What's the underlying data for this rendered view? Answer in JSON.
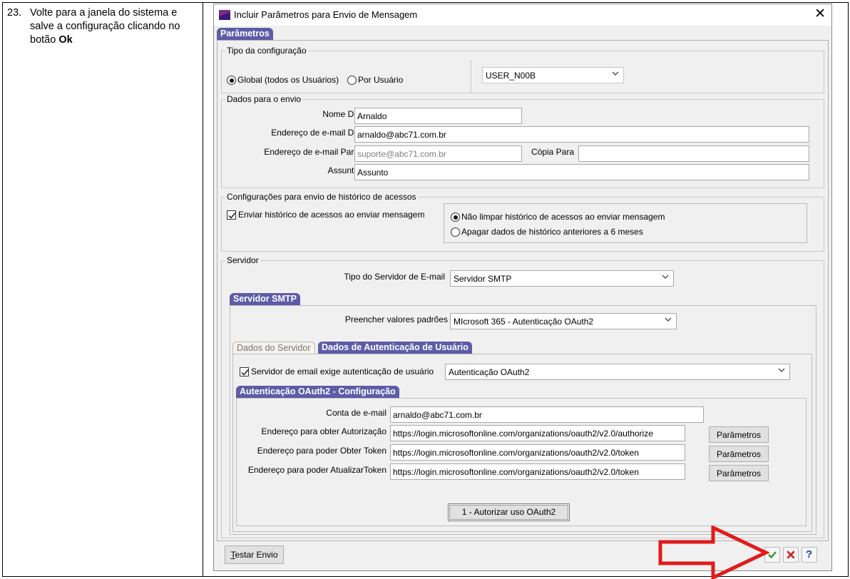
{
  "instruction": {
    "number": "23.",
    "text_before": "Volte para a janela do sistema e salve a configuração clicando no botão ",
    "text_bold": "Ok"
  },
  "dialog": {
    "title": "Incluir Parâmetros para Envio de Mensagem",
    "main_tab": "Parâmetros",
    "tipo_config": {
      "legend": "Tipo da configuração",
      "radio_global": "Global (todos os Usuários)",
      "radio_por_usuario": "Por Usuário",
      "selected": "global",
      "user_combo": "USER_N00B"
    },
    "dados_envio": {
      "legend": "Dados para o envio",
      "nome_de_label": "Nome De",
      "nome_de_value": "Arnaldo",
      "email_de_label": "Endereço de e-mail De",
      "email_de_value": "arnaldo@abc71.com.br",
      "email_para_label": "Endereço de e-mail Para",
      "email_para_placeholder": "suporte@abc71.com.br",
      "copia_para_label": "Cópia Para",
      "copia_para_value": "",
      "assunto_label": "Assunto",
      "assunto_value": "Assunto"
    },
    "historico": {
      "legend": "Configurações para envio de histórico de acessos",
      "checkbox_label": "Enviar histórico de acessos ao enviar mensagem",
      "checkbox_checked": true,
      "radio_nao_limpar": "Não limpar histórico de acessos ao enviar mensagem",
      "radio_apagar": "Apagar dados de histórico anteriores a 6 meses",
      "selected": "nao_limpar"
    },
    "servidor": {
      "legend": "Servidor",
      "tipo_label": "Tipo do Servidor de E-mail",
      "tipo_value": "Servidor SMTP",
      "smtp_tab": "Servidor SMTP",
      "preencher_label": "Preencher valores padrões",
      "preencher_value": "MIcrosoft 365 - Autenticação OAuth2",
      "tab_dados_servidor": "Dados do Servidor",
      "tab_dados_autenticacao": "Dados de Autenticação de Usuário",
      "auth_checkbox_label": "Servidor de email exige autenticação de usuário",
      "auth_checkbox_checked": true,
      "auth_type_value": "Autenticação OAuth2",
      "oauth_tab": "Autenticação OAuth2 - Configuração",
      "conta_label": "Conta de e-mail",
      "conta_value": "arnaldo@abc71.com.br",
      "autorizacao_label": "Endereço para obter Autorização",
      "autorizacao_value": "https://login.microsoftonline.com/organizations/oauth2/v2.0/authorize",
      "token_label": "Endereço para poder Obter Token",
      "token_value": "https://login.microsoftonline.com/organizations/oauth2/v2.0/token",
      "atualizar_label": "Endereço para poder AtualizarToken",
      "atualizar_value": "https://login.microsoftonline.com/organizations/oauth2/v2.0/token",
      "parametros_button": "Parâmetros",
      "autorizar_button": "1 - Autorizar uso OAuth2"
    },
    "footer": {
      "testar_first": "T",
      "testar_rest": "estar Envio",
      "ok_icon": "check-icon",
      "cancel_icon": "cancel-x-icon",
      "help_icon": "question-icon",
      "help_text": "?"
    }
  },
  "colors": {
    "tab_accent": "#5c5ca8",
    "ok_green": "#2e9b2e",
    "cancel_red": "#d11a1a",
    "help_blue": "#1f3fb0",
    "arrow_red": "#e11b1b"
  }
}
